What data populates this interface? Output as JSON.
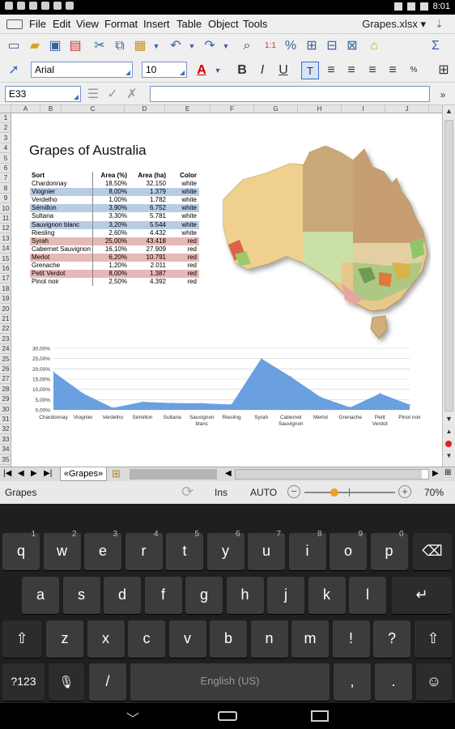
{
  "status": {
    "time": "8:01"
  },
  "menu": {
    "items": [
      "File",
      "Edit",
      "View",
      "Format",
      "Insert",
      "Table",
      "Object",
      "Tools"
    ],
    "doc_title": "Grapes.xlsx ▾"
  },
  "format": {
    "font": "Arial",
    "size": "10"
  },
  "cell_ref": "E33",
  "columns": [
    "A",
    "B",
    "C",
    "D",
    "E",
    "F",
    "G",
    "H",
    "I",
    "J"
  ],
  "rows": [
    "1",
    "2",
    "3",
    "4",
    "5",
    "6",
    "7",
    "8",
    "9",
    "10",
    "11",
    "12",
    "13",
    "14",
    "15",
    "16",
    "17",
    "18",
    "19",
    "20",
    "21",
    "22",
    "23",
    "24",
    "25",
    "26",
    "27",
    "28",
    "29",
    "30",
    "31",
    "32",
    "33",
    "34",
    "35"
  ],
  "doc": {
    "heading": "Grapes of Australia",
    "table": {
      "headers": [
        "Sort",
        "Area (%)",
        "Area (ha)",
        "Color"
      ],
      "rows": [
        [
          "Chardonnay",
          "18,50%",
          "32.150",
          "white"
        ],
        [
          "Viognier",
          "8,00%",
          "1.379",
          "white"
        ],
        [
          "Verdelho",
          "1,00%",
          "1.782",
          "white"
        ],
        [
          "Sémillon",
          "3,90%",
          "6.752",
          "white"
        ],
        [
          "Sultana",
          "3,30%",
          "5.781",
          "white"
        ],
        [
          "Sauvignon blanc",
          "3,20%",
          "5.544",
          "white"
        ],
        [
          "Riesling",
          "2,60%",
          "4.432",
          "white"
        ],
        [
          "Syrah",
          "25,00%",
          "43.418",
          "red"
        ],
        [
          "Cabernet Sauvignon",
          "16,10%",
          "27.909",
          "red"
        ],
        [
          "Merlot",
          "6,20%",
          "10.791",
          "red"
        ],
        [
          "Grenache",
          "1,20%",
          "2.011",
          "red"
        ],
        [
          "Petit Verdot",
          "8,00%",
          "1.387",
          "red"
        ],
        [
          "Pinot noir",
          "2,50%",
          "4.392",
          "red"
        ]
      ]
    }
  },
  "chart_data": {
    "type": "area",
    "categories": [
      "Chardonnay",
      "Viognier",
      "Verdelho",
      "Sémillon",
      "Sultana",
      "Sauvignon blanc",
      "Riesling",
      "Syrah",
      "Cabernet Sauvignon",
      "Merlot",
      "Grenache",
      "Petit Verdot",
      "Pinot noir"
    ],
    "values": [
      18.5,
      8.0,
      1.0,
      3.9,
      3.3,
      3.2,
      2.6,
      25.0,
      16.1,
      6.2,
      1.2,
      8.0,
      2.5
    ],
    "yticks": [
      "0,00%",
      "5,00%",
      "10,00%",
      "15,00%",
      "20,00%",
      "25,00%",
      "30,00%"
    ],
    "ylim": [
      0,
      30
    ],
    "grid": true,
    "color": "#6a9fe0"
  },
  "tabs": {
    "sheet": "«Grapes»"
  },
  "bottom": {
    "sheet_name": "Grapes",
    "mode": "Ins",
    "calc": "AUTO",
    "zoom": "70%",
    "zoom_fraction": 0.33
  },
  "keyboard": {
    "row1": [
      [
        "q",
        "1"
      ],
      [
        "w",
        "2"
      ],
      [
        "e",
        "3"
      ],
      [
        "r",
        "4"
      ],
      [
        "t",
        "5"
      ],
      [
        "y",
        "6"
      ],
      [
        "u",
        "7"
      ],
      [
        "i",
        "8"
      ],
      [
        "o",
        "9"
      ],
      [
        "p",
        "0"
      ]
    ],
    "row2": [
      "a",
      "s",
      "d",
      "f",
      "g",
      "h",
      "j",
      "k",
      "l"
    ],
    "row3": [
      "z",
      "x",
      "c",
      "v",
      "b",
      "n",
      "m",
      "!",
      "?"
    ],
    "sym": "?123",
    "slash": "/",
    "space": "English (US)",
    "comma": ",",
    "period": "."
  },
  "colors": {
    "blue_row": "#b8cce4",
    "red_row": "#e6b8b7",
    "accent": "#3a6fc4"
  }
}
